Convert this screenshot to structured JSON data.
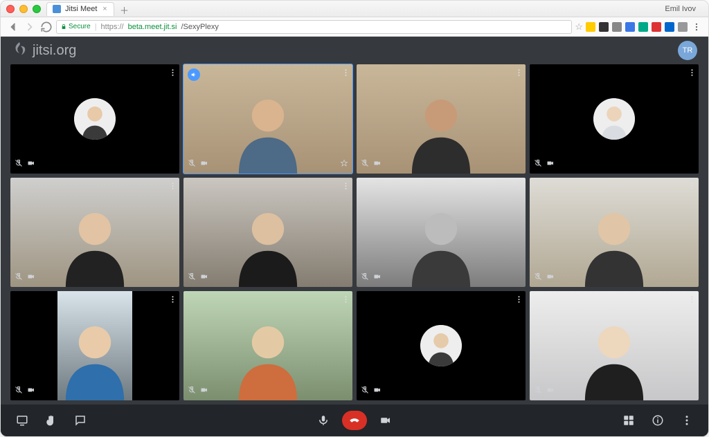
{
  "browser": {
    "profile_name": "Emil Ivov",
    "tab_title": "Jitsi Meet",
    "secure_label": "Secure",
    "url_scheme": "https://",
    "url_host": "beta.meet.jit.si",
    "url_path": "/SexyPlexy"
  },
  "app": {
    "brand_text": "jitsi.org",
    "local_user_initials": "TR"
  },
  "tiles": [
    {
      "id": 0,
      "type": "avatar",
      "avatar_bg": "#f1e6da",
      "muted": true
    },
    {
      "id": 1,
      "type": "video",
      "bg": "bg-room-brown",
      "active": true,
      "dominant": true
    },
    {
      "id": 2,
      "type": "video",
      "bg": "bg-room-brown"
    },
    {
      "id": 3,
      "type": "avatar",
      "avatar_bg": "#dfe3e6",
      "muted": true
    },
    {
      "id": 4,
      "type": "video",
      "bg": "bg-office-1",
      "muted": true
    },
    {
      "id": 5,
      "type": "video",
      "bg": "bg-office-2",
      "muted": true
    },
    {
      "id": 6,
      "type": "video",
      "bg": "bg-bw",
      "muted": true,
      "grayscale": true
    },
    {
      "id": 7,
      "type": "video",
      "bg": "bg-office-3",
      "muted": true
    },
    {
      "id": 8,
      "type": "portrait",
      "muted": true
    },
    {
      "id": 9,
      "type": "video",
      "bg": "bg-room-green",
      "muted": true
    },
    {
      "id": 10,
      "type": "avatar",
      "avatar_bg": "#efece3",
      "muted": true
    },
    {
      "id": 11,
      "type": "video",
      "bg": "bg-room-white",
      "muted": true
    }
  ]
}
